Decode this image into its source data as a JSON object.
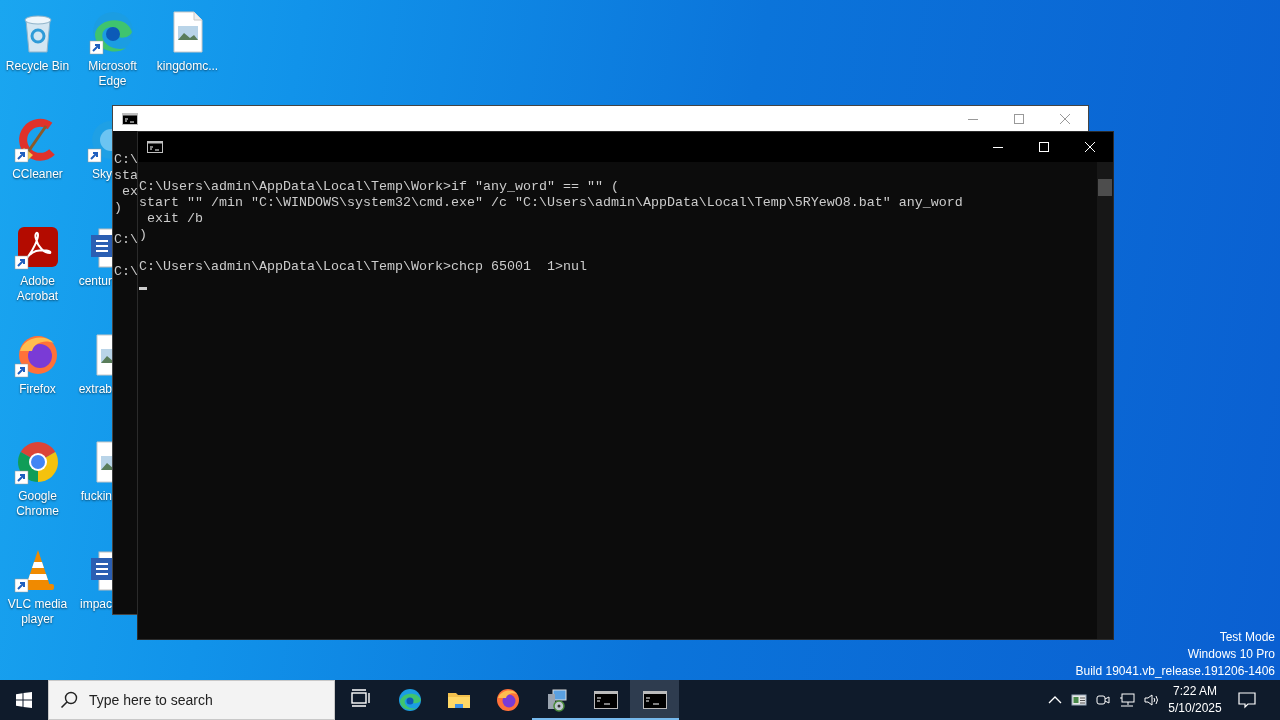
{
  "desktop_icons": [
    {
      "label": "Recycle Bin",
      "kind": "recycle_bin",
      "shortcut": false,
      "covered": false
    },
    {
      "label": "CCleaner",
      "kind": "ccleaner",
      "shortcut": true,
      "covered": false
    },
    {
      "label": "Adobe Acrobat",
      "kind": "acrobat",
      "shortcut": true,
      "covered": false
    },
    {
      "label": "Firefox",
      "kind": "firefox",
      "shortcut": true,
      "covered": false
    },
    {
      "label": "Google Chrome",
      "kind": "chrome",
      "shortcut": true,
      "covered": false
    },
    {
      "label": "VLC media player",
      "kind": "vlc",
      "shortcut": true,
      "covered": false
    },
    {
      "label": "Microsoft Edge",
      "kind": "edge",
      "shortcut": true,
      "covered": false
    },
    {
      "label": "Sky",
      "kind": "skype",
      "shortcut": true,
      "covered": true
    },
    {
      "label": "centur",
      "kind": "word_document",
      "shortcut": false,
      "covered": true
    },
    {
      "label": "extrab",
      "kind": "image_document",
      "shortcut": false,
      "covered": true
    },
    {
      "label": "fuckin",
      "kind": "image_document",
      "shortcut": false,
      "covered": true
    },
    {
      "label": "impac",
      "kind": "word_document",
      "shortcut": false,
      "covered": true
    },
    {
      "label": "kingdomc...",
      "kind": "image_document",
      "shortcut": false,
      "covered": false
    }
  ],
  "windows": [
    {
      "active": false,
      "cursor": false,
      "blocks": [
        [
          "C:\\",
          "sta",
          " ex",
          ")"
        ],
        [
          "C:\\"
        ],
        [
          "C:\\"
        ]
      ]
    },
    {
      "active": true,
      "cursor": true,
      "blocks": [
        [
          "C:\\Users\\admin\\AppData\\Local\\Temp\\Work>if \"any_word\" == \"\" (",
          "start \"\" /min \"C:\\WINDOWS\\system32\\cmd.exe\" /c \"C:\\Users\\admin\\AppData\\Local\\Temp\\5RYewO8.bat\" any_word",
          " exit /b",
          ")"
        ],
        [
          "C:\\Users\\admin\\AppData\\Local\\Temp\\Work>chcp 65001  1>nul"
        ]
      ]
    }
  ],
  "system_info": [
    "Test Mode",
    "Windows 10 Pro",
    "Build 19041.vb_release.191206-1406"
  ],
  "taskbar": {
    "search": {
      "placeholder": "Type here to search"
    },
    "apps": [
      {
        "kind": "task_view",
        "running": false,
        "selected": false
      },
      {
        "kind": "edge",
        "running": false,
        "selected": false
      },
      {
        "kind": "explorer",
        "running": false,
        "selected": false
      },
      {
        "kind": "firefox",
        "running": false,
        "selected": false
      },
      {
        "kind": "installer",
        "running": true,
        "selected": false
      },
      {
        "kind": "cmd",
        "running": true,
        "selected": false
      },
      {
        "kind": "cmd",
        "running": true,
        "selected": true
      }
    ],
    "clock": {
      "time": "7:22 AM",
      "date": "5/10/2025"
    }
  }
}
